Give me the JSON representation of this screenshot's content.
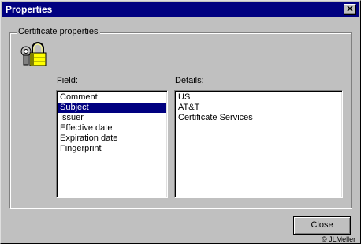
{
  "window": {
    "title": "Properties"
  },
  "group": {
    "label": "Certificate properties"
  },
  "field": {
    "label": "Field:",
    "items": [
      "Comment",
      "Subject",
      "Issuer",
      "Effective date",
      "Expiration date",
      "Fingerprint"
    ],
    "selected_index": 1
  },
  "details": {
    "label": "Details:",
    "lines": [
      "US",
      "AT&T",
      "Certificate Services"
    ]
  },
  "buttons": {
    "close_label": "Close"
  },
  "footer": {
    "copyright": "© JLMeller"
  },
  "colors": {
    "titlebar": "#000080",
    "selection": "#000080",
    "face": "#c0c0c0"
  },
  "icons": {
    "close": "close-icon",
    "certificate": "certificate-lock-icon"
  }
}
